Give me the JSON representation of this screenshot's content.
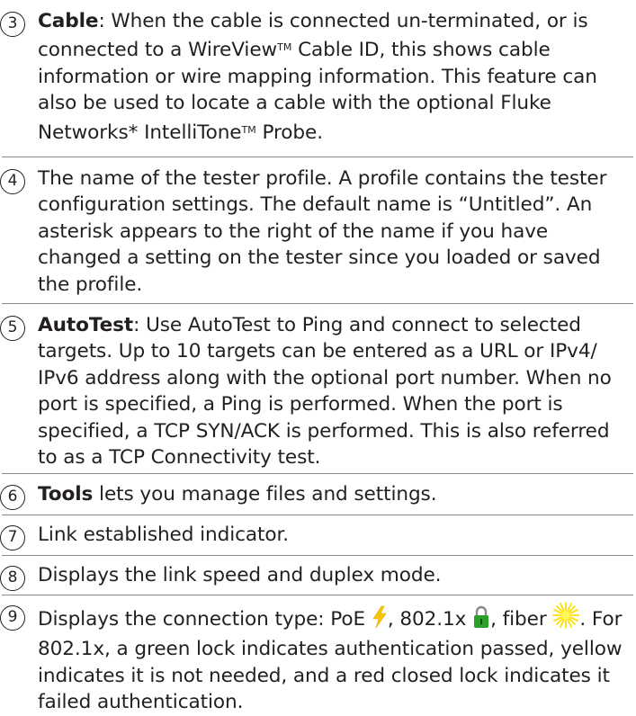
{
  "items": [
    {
      "number": "3",
      "lead": "Cable",
      "text": ": When the cable is connected un-terminated, or is connected to a WireView",
      "tm1": "TM",
      "text2": " Cable ID, this shows cable information or wire mapping information. This feature can also be used to locate a cable with the optional Fluke Networks* IntelliTone",
      "tm2": "TM",
      "text3": " Probe."
    },
    {
      "number": "4",
      "text": "The name of the tester profile. A profile contains the tester configuration settings. The default name is “Untitled”. An asterisk appears to the right of the name if you have changed a setting on the tester since you loaded or saved the profile."
    },
    {
      "number": "5",
      "lead": "AutoTest",
      "text": ": Use AutoTest to Ping and connect to selected targets. Up to 10 targets can be entered as a URL or IPv4/ IPv6 address along with the optional port number. When no port is specified, a Ping is performed. When the port is specified, a TCP SYN/ACK is performed. This is also referred to as a TCP Connectivity test."
    },
    {
      "number": "6",
      "lead": "Tools",
      "text": " lets you manage files and settings."
    },
    {
      "number": "7",
      "text": "Link established indicator."
    },
    {
      "number": "8",
      "text": "Displays the link speed and duplex mode."
    },
    {
      "number": "9",
      "text_a": "Displays the connection type: PoE ",
      "text_b": ", 802.1x ",
      "text_c": ", fiber ",
      "text_d": ". For 802.1x, a green lock indicates authentication passed, yellow indicates it is not needed, and a red closed lock indicates it failed authentication."
    }
  ],
  "icons": {
    "poe": "lightning-bolt-icon",
    "dot1x": "green-lock-icon",
    "fiber": "starburst-icon"
  },
  "colors": {
    "text": "#231f20",
    "rule": "#8a8a8a",
    "poe": "#f7c600",
    "lock": "#2aa02a",
    "fiber": "#ffee00"
  }
}
